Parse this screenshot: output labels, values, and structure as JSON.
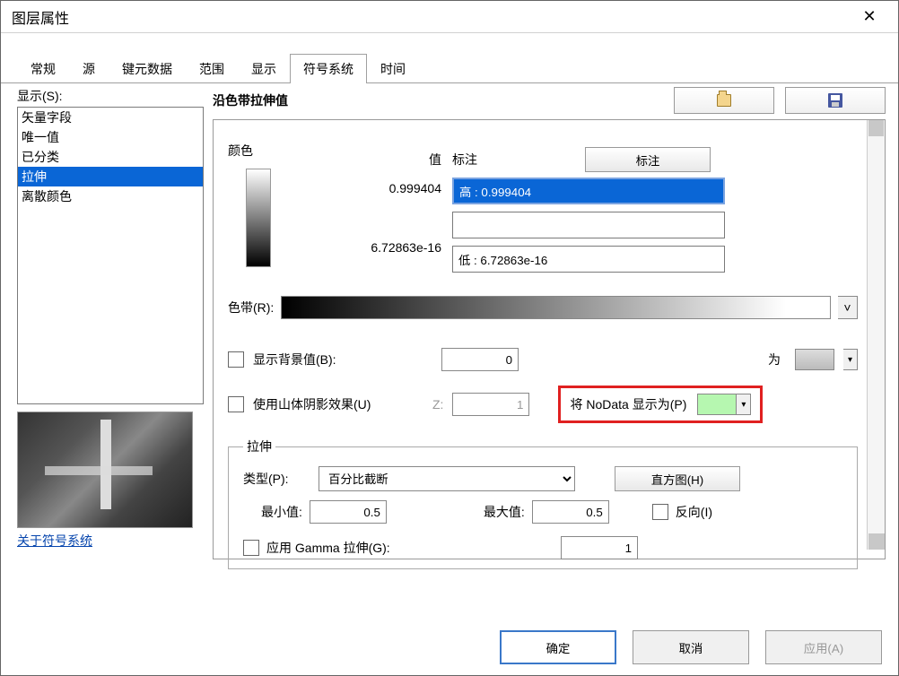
{
  "window": {
    "title": "图层属性"
  },
  "tabs": [
    "常规",
    "源",
    "键元数据",
    "范围",
    "显示",
    "符号系统",
    "时间"
  ],
  "activeTab": "符号系统",
  "sidebar": {
    "label": "显示(S):",
    "items": [
      "矢量字段",
      "唯一值",
      "已分类",
      "拉伸",
      "离散颜色"
    ],
    "selected": "拉伸",
    "aboutLink": "关于符号系统"
  },
  "panel": {
    "header": "沿色带拉伸值",
    "colorLabel": "颜色",
    "valueLabel": "值",
    "annotationLabel": "标注",
    "annotateBtn": "标注",
    "highValue": "0.999404",
    "highLabel": "高 : 0.999404",
    "midLabel": "",
    "lowValue": "6.72863e-16",
    "lowLabel": "低 : 6.72863e-16",
    "rampLabel": "色带(R):",
    "showBgLabel": "显示背景值(B):",
    "bgValue": "0",
    "asLabel": "为",
    "hillshadeLabel": "使用山体阴影效果(U)",
    "zLabel": "Z:",
    "zValue": "1",
    "noDataLabel": "将 NoData 显示为(P)",
    "stretch": {
      "legend": "拉伸",
      "typeLabel": "类型(P):",
      "typeValue": "百分比截断",
      "histogramBtn": "直方图(H)",
      "minLabel": "最小值:",
      "minValue": "0.5",
      "maxLabel": "最大值:",
      "maxValue": "0.5",
      "invertLabel": "反向(I)",
      "gammaLabel": "应用 Gamma 拉伸(G):",
      "gammaValue": "1"
    }
  },
  "footer": {
    "ok": "确定",
    "cancel": "取消",
    "apply": "应用(A)"
  }
}
